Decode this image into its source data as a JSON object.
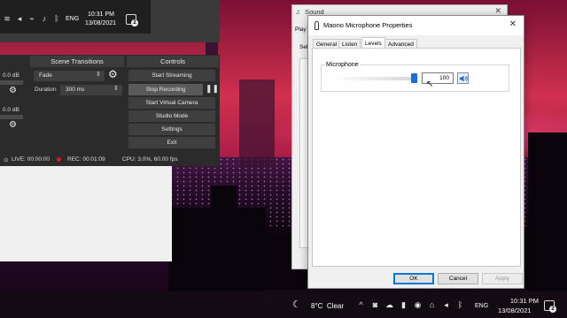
{
  "obs": {
    "tray": {
      "language": "ENG",
      "time": "10:31 PM",
      "date": "13/08/2021",
      "notification_count": "2"
    },
    "audio_mixer": {
      "db_top": "0.0 dB",
      "db_bottom": "0.0 dB"
    },
    "scene_transitions": {
      "title": "Scene Transitions",
      "transition": "Fade",
      "duration_label": "Duration",
      "duration_value": "300 ms"
    },
    "controls": {
      "title": "Controls",
      "start_streaming": "Start Streaming",
      "stop_recording": "Stop Recording",
      "start_virtual_camera": "Start Virtual Camera",
      "studio_mode": "Studio Mode",
      "settings": "Settings",
      "exit": "Exit"
    },
    "status": {
      "live": "LIVE: 00:00:00",
      "rec": "REC: 00:01:09",
      "cpu": "CPU: 3.0%, 60.00 fps"
    }
  },
  "sound_dialog": {
    "title": "Sound",
    "tab_partial": "Play",
    "label_partial": "Sel"
  },
  "properties": {
    "title": "Maono Microphone Properties",
    "tabs": [
      "General",
      "Listen",
      "Levels",
      "Advanced"
    ],
    "selected_tab": "Levels",
    "group_label": "Microphone",
    "level_value": "100",
    "level_fraction": 1.0,
    "buttons": {
      "ok": "OK",
      "cancel": "Cancel",
      "apply": "Apply"
    }
  },
  "taskbar": {
    "weather_temp": "8°C",
    "weather_text": "Clear",
    "language": "ENG",
    "time": "10:31 PM",
    "date": "13/08/2021",
    "notification_count": "2"
  },
  "colors": {
    "accent_blue": "#1f6fd1",
    "obs_dark": "#2b2b2b",
    "recording_red": "#d02020"
  }
}
